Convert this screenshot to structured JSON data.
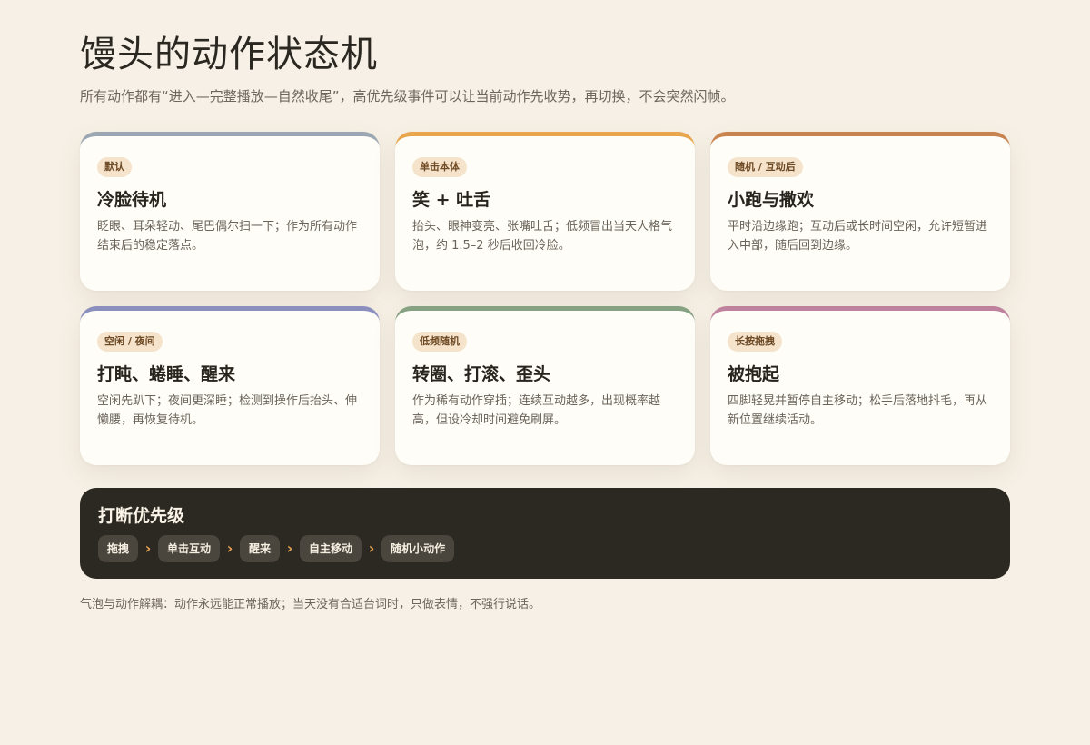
{
  "page": {
    "title": "馒头的动作状态机",
    "subtitle": "所有动作都有“进入—完整播放—自然收尾”，高优先级事件可以让当前动作先收势，再切换，不会突然闪帧。",
    "footnote": "气泡与动作解耦：动作永远能正常播放；当天没有合适台词时，只做表情，不强行说话。"
  },
  "states": [
    {
      "tag": "默认",
      "title": "冷脸待机",
      "desc": "眨眼、耳朵轻动、尾巴偶尔扫一下；作为所有动作结束后的稳定落点。",
      "accent": "#9aa7b3"
    },
    {
      "tag": "单击本体",
      "title": "笑 + 吐舌",
      "desc": "抬头、眼神变亮、张嘴吐舌；低频冒出当天人格气泡，约 1.5–2 秒后收回冷脸。",
      "accent": "#e8a54a"
    },
    {
      "tag": "随机 / 互动后",
      "title": "小跑与撒欢",
      "desc": "平时沿边缘跑；互动后或长时间空闲，允许短暂进入中部，随后回到边缘。",
      "accent": "#c9834f"
    },
    {
      "tag": "空闲 / 夜间",
      "title": "打盹、蜷睡、醒来",
      "desc": "空闲先趴下；夜间更深睡；检测到操作后抬头、伸懒腰，再恢复待机。",
      "accent": "#8a8fbe"
    },
    {
      "tag": "低频随机",
      "title": "转圈、打滚、歪头",
      "desc": "作为稀有动作穿插；连续互动越多，出现概率越高，但设冷却时间避免刷屏。",
      "accent": "#86a283"
    },
    {
      "tag": "长按拖拽",
      "title": "被抱起",
      "desc": "四脚轻晃并暂停自主移动；松手后落地抖毛，再从新位置继续活动。",
      "accent": "#bf829e"
    }
  ],
  "priority": {
    "title": "打断优先级",
    "separator": "›",
    "items": [
      "拖拽",
      "单击互动",
      "醒来",
      "自主移动",
      "随机小动作"
    ]
  }
}
